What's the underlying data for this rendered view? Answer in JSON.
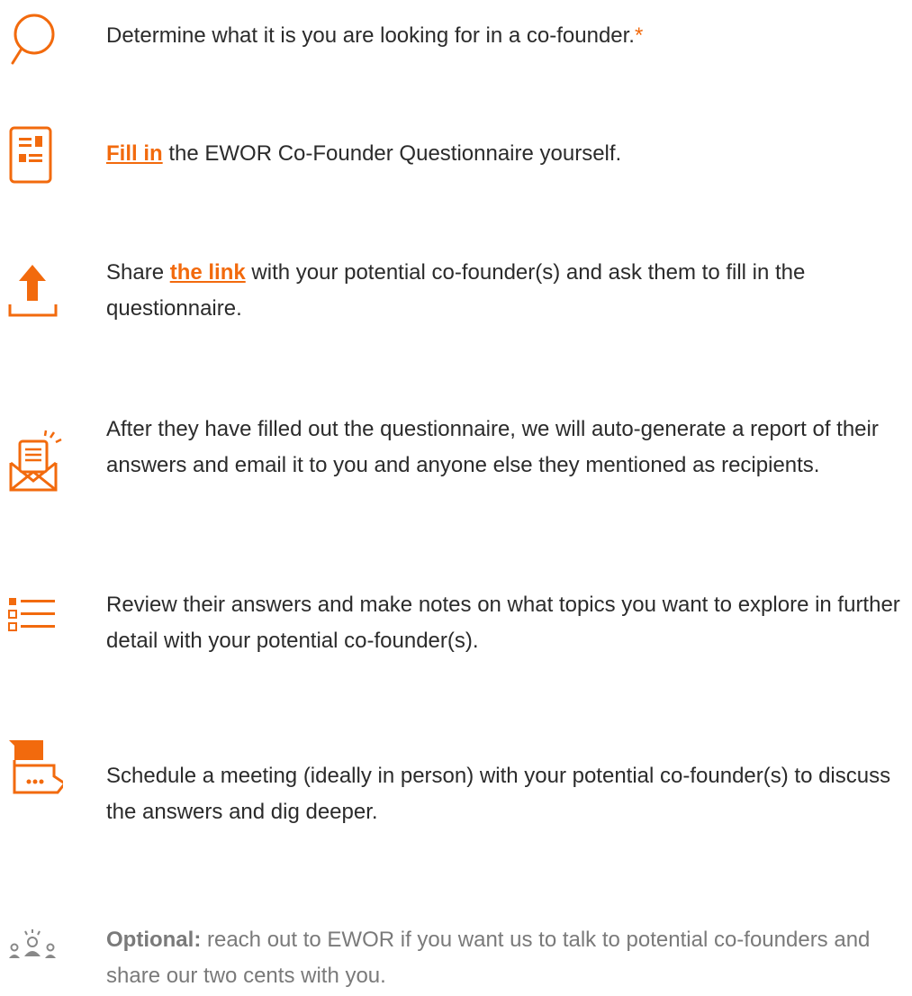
{
  "colors": {
    "accent": "#f26a0d",
    "text": "#2b2b2b",
    "muted": "#7a7a7a"
  },
  "steps": [
    {
      "icon": "search-icon",
      "text": "Determine what it is you are looking for in a co-founder.",
      "asterisk": "*"
    },
    {
      "icon": "questionnaire-document-icon",
      "link_text": "Fill in",
      "text": " the EWOR Co-Founder Questionnaire yourself."
    },
    {
      "icon": "upload-share-icon",
      "text_before": "Share ",
      "link_text": "the link",
      "text_after": " with your potential co-founder(s) and ask them to fill in the questionnaire."
    },
    {
      "icon": "email-report-icon",
      "text": "After they have filled out the questionnaire, we will auto-generate a report of their answers and email it to you and anyone else they mentioned as recipients."
    },
    {
      "icon": "list-icon",
      "text": "Review their answers and make notes on what topics you want to explore in further detail with your potential co-founder(s)."
    },
    {
      "icon": "meeting-chat-icon",
      "text": "Schedule a meeting (ideally in person) with your potential co-founder(s) to discuss the answers and dig deeper."
    },
    {
      "icon": "people-group-icon",
      "label": "Optional:",
      "text": " reach out to EWOR if you want us to talk to potential co-founders and share our two cents with you."
    }
  ]
}
